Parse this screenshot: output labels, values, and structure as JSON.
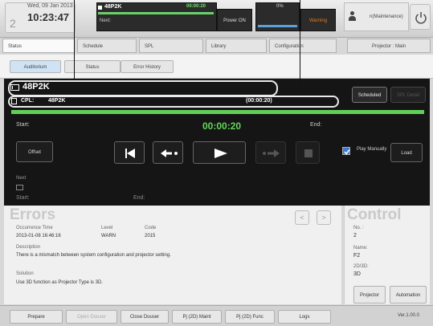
{
  "header": {
    "day_number": "2",
    "date": "Wed, 09 Jan 2013",
    "time": "10:23:47",
    "now_playing": {
      "title": "48P2K",
      "elapsed": "00:00:20",
      "next_label": "Next:"
    },
    "power_label": "Power ON",
    "storage_percent": "0%",
    "warning_label": "Warning",
    "user": "n(Maintenance)"
  },
  "nav": {
    "tabs": [
      "Status",
      "Schedule",
      "SPL",
      "Library",
      "Configuration"
    ],
    "projector_select": "Projector : Main"
  },
  "subtabs": [
    "Auditorium",
    "Status",
    "Error History"
  ],
  "player": {
    "show_title": "48P2K",
    "cpl_label": "CPL:",
    "cpl_value": "48P2K",
    "cpl_duration": "(00:00:20)",
    "scheduled_label": "Scheduled",
    "spl_detail_label": "SPL Detail",
    "start_label": "Start:",
    "current_time": "00:00:20",
    "end_label": "End:",
    "offset_label": "Offset",
    "play_manually_label": "Play Manually",
    "load_label": "Load",
    "next_label": "Next",
    "next_start_label": "Start:",
    "next_end_label": "End:",
    "progress": 1.0
  },
  "errors": {
    "title": "Errors",
    "occurrence_time_header": "Occurrence Time",
    "level_header": "Level",
    "code_header": "Code",
    "occurrence_time": "2013-01-08 16:46:16",
    "level": "WARN",
    "code": "2015",
    "description_header": "Description",
    "description": "There is a mismatch between system configuration and projector setting.",
    "solution_header": "Solution",
    "solution": "Use 3D function as Projector Type is 3D.",
    "prev_arrow": "<",
    "next_arrow": ">"
  },
  "control": {
    "title": "Control",
    "no_label": "No. :",
    "no_value": "2",
    "name_label": "Name:",
    "name_value": "F2",
    "mode_label": "2D/3D:",
    "mode_value": "3D",
    "projector_button": "Projector",
    "automation_button": "Automation"
  },
  "footer": {
    "buttons": [
      "Prepare",
      "Open Douser",
      "Close Douser",
      "Pj (2D) Maint",
      "Pj (2D) Func",
      "Logs"
    ],
    "version": "Ver.1.00.0"
  },
  "colors": {
    "progress": "#5fcf57",
    "time_green": "#62d65a",
    "checkbox": "#3a7bd5",
    "warning": "#e07a1a"
  }
}
